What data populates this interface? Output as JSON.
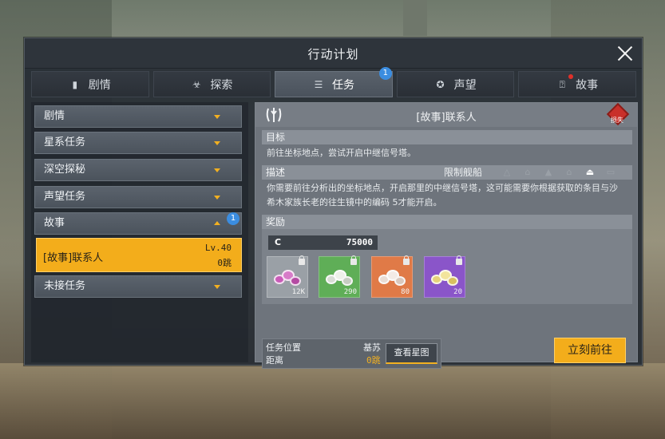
{
  "window": {
    "title": "行动计划"
  },
  "tabs": [
    {
      "label": "剧情",
      "icon": "book-icon"
    },
    {
      "label": "探索",
      "icon": "explore-icon"
    },
    {
      "label": "任务",
      "icon": "clipboard-icon",
      "badge": "1"
    },
    {
      "label": "声望",
      "icon": "medal-icon"
    },
    {
      "label": "故事",
      "icon": "story-icon"
    }
  ],
  "categories": [
    {
      "label": "剧情"
    },
    {
      "label": "星系任务"
    },
    {
      "label": "深空探秘"
    },
    {
      "label": "声望任务"
    },
    {
      "label": "故事",
      "badge": "1"
    },
    {
      "label": "未接任务"
    }
  ],
  "selected_quest": {
    "name": "[故事]联系人",
    "level": "Lv.40",
    "distance": "0跳"
  },
  "detail": {
    "title": "[故事]联系人",
    "lost_label": "损失",
    "objective_label": "目标",
    "objective_text": "前往坐标地点，尝试开启中继信号塔。",
    "desc_label": "描述",
    "ship_limit_label": "限制舰船",
    "desc_text": "你需要前往分析出的坐标地点，开启那里的中继信号塔，这可能需要你根据获取的条目与沙希木家族长老的往生镜中的编码 5才能开启。",
    "reward_label": "奖励",
    "credit_label": "C",
    "credit_value": "75000",
    "rewards": [
      {
        "qty": "12K",
        "color": "#c95bb8"
      },
      {
        "qty": "290",
        "color": "#5fae57"
      },
      {
        "qty": "80",
        "color": "#e07a47"
      },
      {
        "qty": "20",
        "color": "#8a55c9"
      }
    ],
    "location_label": "任务位置",
    "location_value": "基苏",
    "distance_label": "距离",
    "distance_value": "0跳",
    "view_map_label": "查看星图",
    "go_label": "立刻前往"
  }
}
